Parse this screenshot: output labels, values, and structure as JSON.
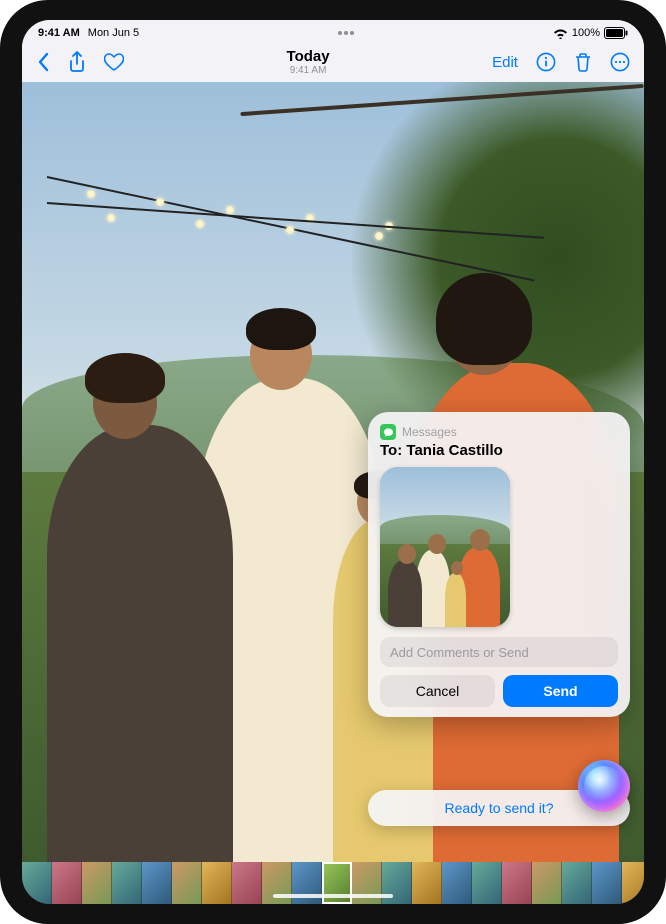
{
  "status": {
    "time": "9:41 AM",
    "date": "Mon Jun 5",
    "battery_percent": "100%"
  },
  "nav": {
    "title": "Today",
    "subtitle": "9:41 AM",
    "edit": "Edit"
  },
  "siri_card": {
    "app_name": "Messages",
    "to_prefix": "To:",
    "recipient": "Tania Castillo",
    "comment_placeholder": "Add Comments or Send",
    "cancel": "Cancel",
    "send": "Send"
  },
  "siri_prompt": "Ready to send it?"
}
